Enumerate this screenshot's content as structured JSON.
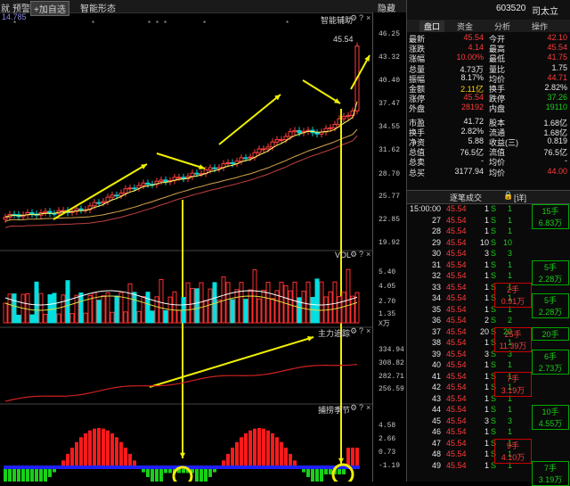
{
  "toolbar": {
    "item1": "就",
    "item2": "预警",
    "add_btn": "+加自选",
    "item4": "智能形态",
    "right": "隐藏"
  },
  "chart": {
    "left_readout": "14.785",
    "main_panel_title": "智能辅助",
    "high_price_label": "45.54",
    "price_axis": [
      "46.25",
      "43.32",
      "40.40",
      "37.47",
      "34.55",
      "31.62",
      "28.70",
      "25.77",
      "22.85",
      "19.92"
    ],
    "volume_panel_title": "VOL",
    "volume_axis": [
      "5.40",
      "4.05",
      "2.70",
      "1.35",
      "0.00"
    ],
    "volume_unit": "X万",
    "panel3_title": "主力追踪",
    "panel3_axis": [
      "334.94",
      "308.82",
      "282.71",
      "256.59"
    ],
    "panel4_title": "捕捞季节",
    "panel4_axis": [
      "4.58",
      "2.66",
      "0.73",
      "-1.19"
    ],
    "icons": [
      "gear-icon",
      "help-icon",
      "close-icon"
    ]
  },
  "quote_header": {
    "code": "603520",
    "name": "司太立",
    "tabs": [
      "盘口",
      "资金",
      "分析",
      "操作"
    ],
    "active_tab": "盘口"
  },
  "quote_rows": [
    {
      "l1": "最新",
      "v1": "45.54",
      "c1": "red",
      "l2": "今开",
      "v2": "42.10",
      "c2": "red"
    },
    {
      "l1": "涨跌",
      "v1": "4.14",
      "c1": "red",
      "l2": "最高",
      "v2": "45.54",
      "c2": "red"
    },
    {
      "l1": "涨幅",
      "v1": "10.00%",
      "c1": "red",
      "l2": "最低",
      "v2": "41.75",
      "c2": "red"
    },
    {
      "l1": "总量",
      "v1": "4.73万",
      "c1": "wht",
      "l2": "量比",
      "v2": "1.75",
      "c2": "wht"
    },
    {
      "l1": "振幅",
      "v1": "8.17%",
      "c1": "wht",
      "l2": "均价",
      "v2": "44.71",
      "c2": "red"
    },
    {
      "l1": "金额",
      "v1": "2.11亿",
      "c1": "yel",
      "l2": "换手",
      "v2": "2.82%",
      "c2": "wht"
    },
    {
      "l1": "涨停",
      "v1": "45.54",
      "c1": "red",
      "l2": "跌停",
      "v2": "37.26",
      "c2": "grn"
    },
    {
      "l1": "外盘",
      "v1": "28192",
      "c1": "red",
      "l2": "内盘",
      "v2": "19110",
      "c2": "grn"
    },
    {
      "l1": "市盈",
      "v1": "41.72",
      "c1": "wht",
      "l2": "股本",
      "v2": "1.68亿",
      "c2": "wht"
    },
    {
      "l1": "换手",
      "v1": "2.82%",
      "c1": "wht",
      "l2": "流通",
      "v2": "1.68亿",
      "c2": "wht"
    },
    {
      "l1": "净资",
      "v1": "5.88",
      "c1": "wht",
      "l2": "收益(三)",
      "v2": "0.819",
      "c2": "wht"
    },
    {
      "l1": "总值",
      "v1": "76.5亿",
      "c1": "wht",
      "l2": "流值",
      "v2": "76.5亿",
      "c2": "wht"
    },
    {
      "l1": "总卖",
      "v1": "-",
      "c1": "wht",
      "l2": "均价",
      "v2": "-",
      "c2": "wht"
    },
    {
      "l1": "总买",
      "v1": "3177.94",
      "c1": "wht",
      "l2": "均价",
      "v2": "44.00",
      "c2": "red"
    }
  ],
  "tx_header": {
    "title": "逐笔成交",
    "detail": "[详]"
  },
  "tx_rows": [
    {
      "t": "15:00:00",
      "p": "45.54",
      "v": "1",
      "s": "S",
      "v2": "1"
    },
    {
      "t": "27",
      "p": "45.54",
      "v": "1",
      "s": "S",
      "v2": "1"
    },
    {
      "t": "28",
      "p": "45.54",
      "v": "1",
      "s": "S",
      "v2": "1"
    },
    {
      "t": "29",
      "p": "45.54",
      "v": "10",
      "s": "S",
      "v2": "10"
    },
    {
      "t": "30",
      "p": "45.54",
      "v": "3",
      "s": "S",
      "v2": "3"
    },
    {
      "t": "31",
      "p": "45.54",
      "v": "1",
      "s": "S",
      "v2": "1"
    },
    {
      "t": "32",
      "p": "45.54",
      "v": "1",
      "s": "S",
      "v2": "1"
    },
    {
      "t": "33",
      "p": "45.54",
      "v": "1",
      "s": "S",
      "v2": "1"
    },
    {
      "t": "34",
      "p": "45.54",
      "v": "1",
      "s": "S",
      "v2": "1"
    },
    {
      "t": "35",
      "p": "45.54",
      "v": "1",
      "s": "S",
      "v2": "1"
    },
    {
      "t": "36",
      "p": "45.54",
      "v": "2",
      "s": "S",
      "v2": "2"
    },
    {
      "t": "37",
      "p": "45.54",
      "v": "20",
      "s": "S",
      "v2": "20"
    },
    {
      "t": "38",
      "p": "45.54",
      "v": "1",
      "s": "S",
      "v2": "1"
    },
    {
      "t": "39",
      "p": "45.54",
      "v": "3",
      "s": "S",
      "v2": "3"
    },
    {
      "t": "40",
      "p": "45.54",
      "v": "1",
      "s": "S",
      "v2": "1"
    },
    {
      "t": "41",
      "p": "45.54",
      "v": "1",
      "s": "S",
      "v2": "1"
    },
    {
      "t": "42",
      "p": "45.54",
      "v": "1",
      "s": "S",
      "v2": "1"
    },
    {
      "t": "43",
      "p": "45.54",
      "v": "1",
      "s": "S",
      "v2": "1"
    },
    {
      "t": "44",
      "p": "45.54",
      "v": "1",
      "s": "S",
      "v2": "1"
    },
    {
      "t": "45",
      "p": "45.54",
      "v": "3",
      "s": "S",
      "v2": "3"
    },
    {
      "t": "46",
      "p": "45.54",
      "v": "1",
      "s": "S",
      "v2": "1"
    },
    {
      "t": "47",
      "p": "45.54",
      "v": "1",
      "s": "S",
      "v2": "1"
    },
    {
      "t": "48",
      "p": "45.54",
      "v": "1",
      "s": "S",
      "v2": "1"
    },
    {
      "t": "49",
      "p": "45.54",
      "v": "1",
      "s": "S",
      "v2": "1"
    }
  ],
  "tx_blocks": [
    {
      "a": "15手",
      "b": "6.83万",
      "row": 0,
      "col": 1
    },
    {
      "a": "5手",
      "b": "2.28万",
      "row": 5,
      "col": 1
    },
    {
      "a": "2手",
      "b": "0.91万",
      "row": 7,
      "col": 0
    },
    {
      "a": "5手",
      "b": "2.28万",
      "row": 8,
      "col": 1
    },
    {
      "a": "25手",
      "b": "11.39万",
      "row": 11,
      "col": 0
    },
    {
      "a": "20手",
      "b": "",
      "row": 11,
      "col": 1
    },
    {
      "a": "6手",
      "b": "2.73万",
      "row": 13,
      "col": 1
    },
    {
      "a": "7手",
      "b": "3.19万",
      "row": 15,
      "col": 0
    },
    {
      "a": "10手",
      "b": "4.55万",
      "row": 18,
      "col": 1
    },
    {
      "a": "9手",
      "b": "4.10万",
      "row": 21,
      "col": 0
    },
    {
      "a": "7手",
      "b": "3.19万",
      "row": 23,
      "col": 1
    }
  ]
}
